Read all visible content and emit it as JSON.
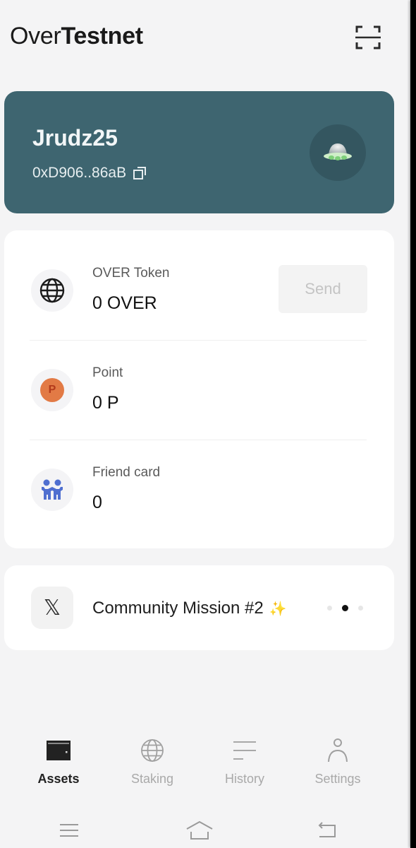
{
  "header": {
    "title_light": "Over",
    "title_bold": "Testnet",
    "scan_icon": "scan-icon"
  },
  "profile": {
    "name": "Jrudz25",
    "address": "0xD906..86aB",
    "copy_icon": "copy-icon",
    "avatar_icon": "ufo-icon",
    "card_color": "#3e6570"
  },
  "assets": [
    {
      "icon": "globe-icon",
      "label": "OVER Token",
      "value": "0 OVER",
      "action_label": "Send"
    },
    {
      "icon": "point-badge-icon",
      "badge_letter": "P",
      "label": "Point",
      "value": "0 P"
    },
    {
      "icon": "friends-icon",
      "label": "Friend card",
      "value": "0"
    }
  ],
  "mission": {
    "icon": "x-logo-icon",
    "icon_glyph": "𝕏",
    "title": "Community Mission #2",
    "sparkle": "✨",
    "carousel": {
      "total": 3,
      "active_index": 1
    }
  },
  "bottom_nav": [
    {
      "label": "Assets",
      "icon": "wallet-icon",
      "active": true
    },
    {
      "label": "Staking",
      "icon": "globe-icon",
      "active": false
    },
    {
      "label": "History",
      "icon": "list-icon",
      "active": false
    },
    {
      "label": "Settings",
      "icon": "person-icon",
      "active": false
    }
  ],
  "system_nav": [
    "menu-icon",
    "home-icon",
    "back-icon"
  ],
  "colors": {
    "accent": "#3e6570",
    "point_badge": "#e27a45",
    "friends": "#4f6fd0",
    "background": "#f4f4f5"
  }
}
